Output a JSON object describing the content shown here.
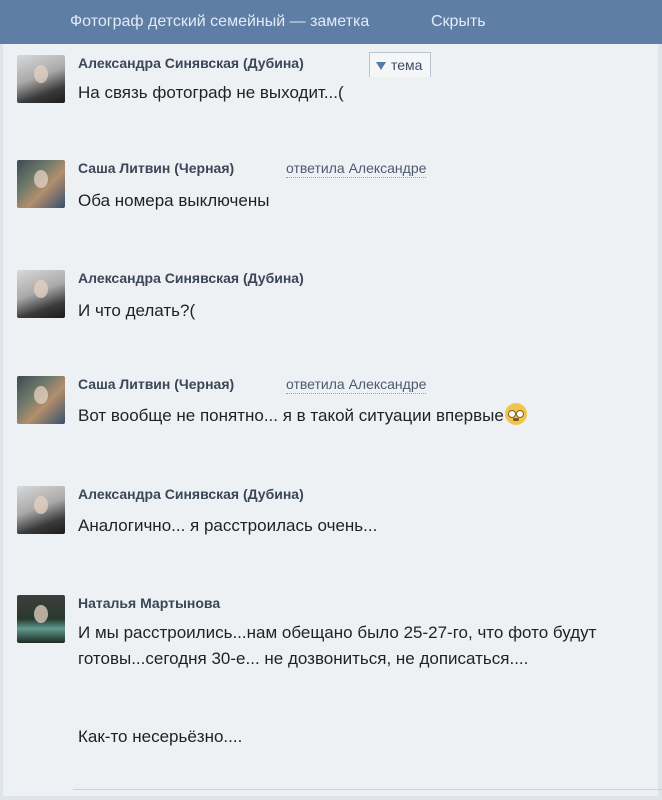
{
  "header": {
    "title": "Фотограф детский семейный — заметка",
    "hide_label": "Скрыть"
  },
  "tag": {
    "label": "тема"
  },
  "posts": [
    {
      "author": "Александра Синявская (Дубина)",
      "reply": "",
      "text": "На связь фотограф не выходит...("
    },
    {
      "author": "Саша Литвин (Черная)",
      "reply": "ответила Александре",
      "text": "Оба номера выключены"
    },
    {
      "author": "Александра Синявская (Дубина)",
      "reply": "",
      "text": "И что делать?("
    },
    {
      "author": "Саша Литвин (Черная)",
      "reply": "ответила Александре",
      "text": "Вот вообще  не понятно... я в такой ситуации впервые"
    },
    {
      "author": "Александра Синявская (Дубина)",
      "reply": "",
      "text": "Аналогично... я расстроилась очень..."
    },
    {
      "author": "Наталья Мартынова",
      "reply": "",
      "text": "И мы расстроились...нам обещано было 25-27-го, что фото будут готовы...сегодня 30-е...  не дозвониться, не дописаться....\n\n\nКак-то несерьёзно...."
    }
  ],
  "icons": [
    "dropdown-triangle-icon",
    "rolling-eyes-emoji-icon"
  ]
}
